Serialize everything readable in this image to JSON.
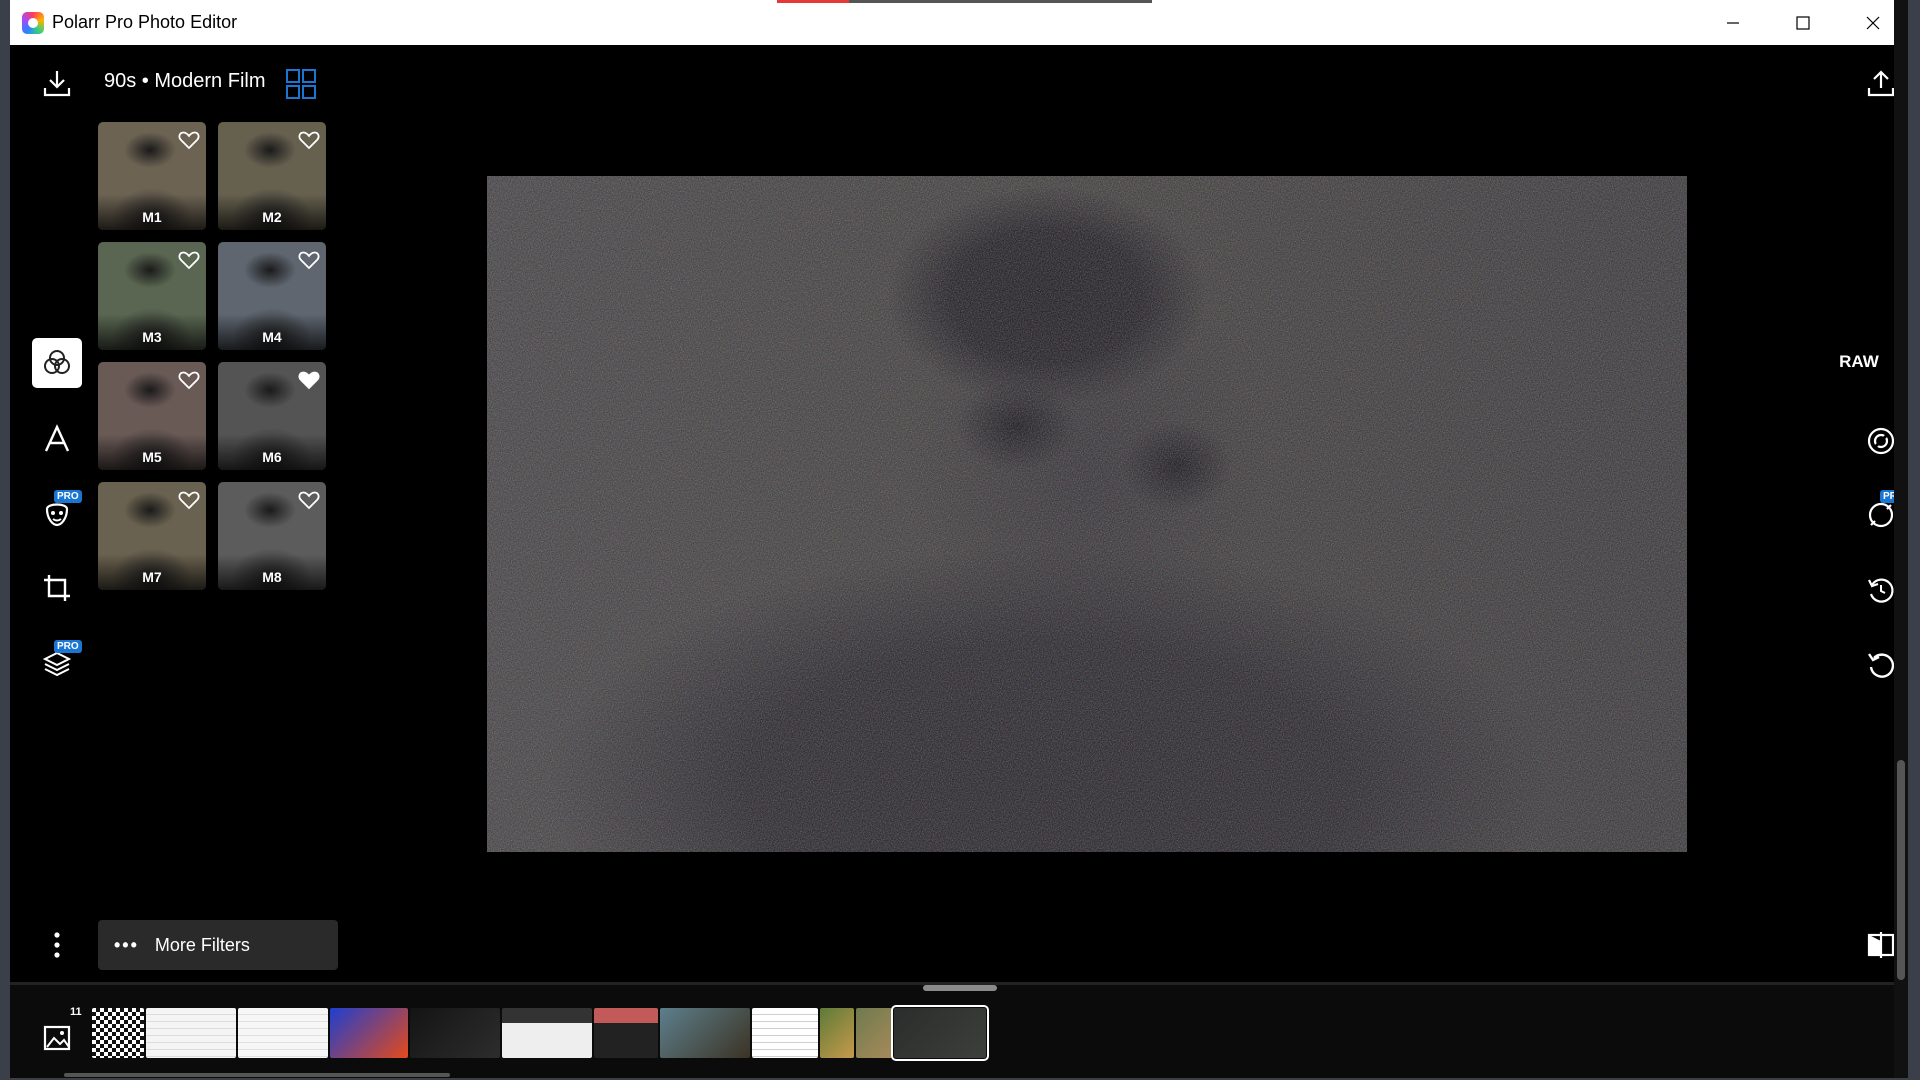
{
  "window": {
    "title": "Polarr Pro Photo Editor"
  },
  "filters_panel": {
    "title": "90s • Modern Film",
    "items": [
      {
        "label": "M1",
        "favorited": false,
        "tint": "#6d6353"
      },
      {
        "label": "M2",
        "favorited": false,
        "tint": "#66604f"
      },
      {
        "label": "M3",
        "favorited": false,
        "tint": "#5a6651"
      },
      {
        "label": "M4",
        "favorited": false,
        "tint": "#5f6670"
      },
      {
        "label": "M5",
        "favorited": false,
        "tint": "#6a5a56"
      },
      {
        "label": "M6",
        "favorited": true,
        "tint": "#545454"
      },
      {
        "label": "M7",
        "favorited": false,
        "tint": "#6a6250"
      },
      {
        "label": "M8",
        "favorited": false,
        "tint": "#5c5c5c"
      }
    ],
    "more_filters_label": "More Filters"
  },
  "left_rail": {
    "tools": [
      "filters-icon",
      "text-icon",
      "face-retouch-icon",
      "crop-icon",
      "layers-icon",
      "more-icon"
    ],
    "pro_badge": "PRO"
  },
  "right_rail": {
    "raw_label": "RAW",
    "tools": [
      "auto-enhance-icon",
      "brush-icon",
      "history-icon",
      "reset-icon",
      "compare-icon"
    ],
    "pro_badge": "PRO"
  },
  "gallery": {
    "count": "11",
    "thumbnails": [
      {
        "kind": "qr",
        "colors": [
          "#ffffff",
          "#111111"
        ]
      },
      {
        "kind": "document",
        "colors": [
          "#f4f4f4",
          "#dddddd"
        ]
      },
      {
        "kind": "document",
        "colors": [
          "#f6f6f6",
          "#e0e0e0"
        ]
      },
      {
        "kind": "photo",
        "colors": [
          "#1e3fcf",
          "#e44a1a"
        ]
      },
      {
        "kind": "photo",
        "colors": [
          "#141414",
          "#2d2d2d"
        ]
      },
      {
        "kind": "screenshot",
        "colors": [
          "#eeeeee",
          "#333333"
        ]
      },
      {
        "kind": "screenshot",
        "colors": [
          "#222222",
          "#c25a5a"
        ]
      },
      {
        "kind": "photo",
        "colors": [
          "#5d7f8c",
          "#3b3324"
        ]
      },
      {
        "kind": "document",
        "colors": [
          "#ffffff",
          "#cfcfcf"
        ]
      },
      {
        "kind": "photo",
        "colors": [
          "#5e7a3a",
          "#c79a4a"
        ]
      },
      {
        "kind": "photo",
        "colors": [
          "#6f7a4e",
          "#a78a5a"
        ]
      },
      {
        "kind": "photo",
        "colors": [
          "#2b2d2c",
          "#3d3f3c"
        ],
        "selected": true
      }
    ]
  },
  "colors": {
    "accent": "#1976d2",
    "background": "#000000",
    "pro_badge": "#1976d2"
  }
}
